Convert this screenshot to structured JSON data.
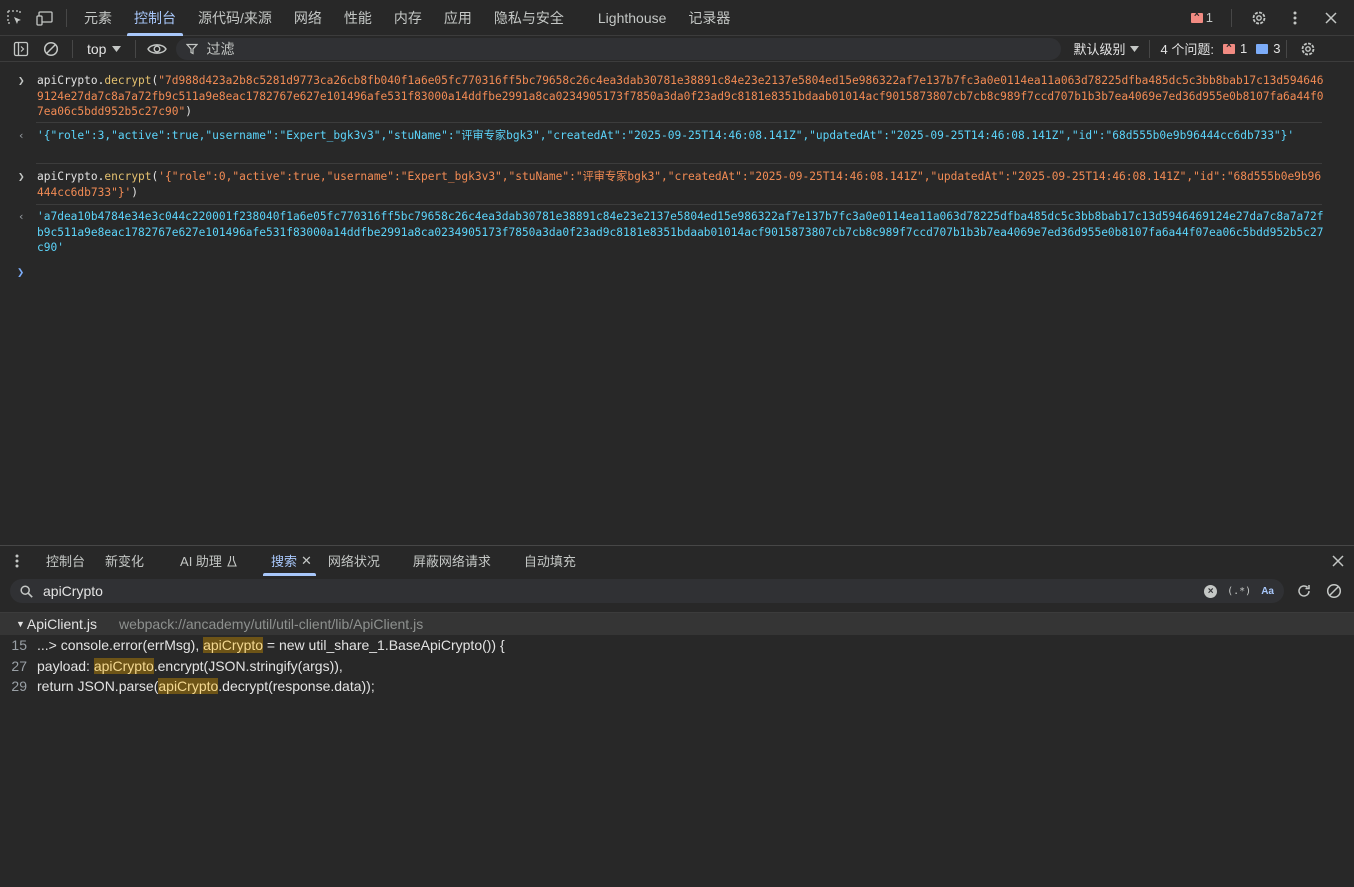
{
  "main_tabs": {
    "items": [
      "元素",
      "控制台",
      "源代码/来源",
      "网络",
      "性能",
      "内存",
      "应用",
      "隐私与安全",
      "Lighthouse",
      "记录器"
    ],
    "active_index": 1,
    "error_count": "1"
  },
  "console_toolbar": {
    "context": "top",
    "filter_placeholder": "过滤",
    "level": "默认级别",
    "issues_label": "4 个问题:",
    "issues_errors": "1",
    "issues_info": "3"
  },
  "console": {
    "msg1": {
      "obj": "apiCrypto",
      "dot": ".",
      "method": "decrypt",
      "open": "(",
      "arg": "\"7d988d423a2b8c5281d9773ca26cb8fb040f1a6e05fc770316ff5bc79658c26c4ea3dab30781e38891c84e23e2137e5804ed15e986322af7e137b7fc3a0e0114ea11a063d78225dfba485dc5c3bb8bab17c13d5946469124e27da7c8a7a72fb9c511a9e8eac1782767e627e101496afe531f83000a14ddfbe2991a8ca0234905173f7850a3da0f23ad9c8181e8351bdaab01014acf9015873807cb7cb8c989f7ccd707b1b3b7ea4069e7ed36d955e0b8107fa6a44f07ea06c5bdd952b5c27c90\"",
      "close": ")"
    },
    "result1": "'{\"role\":3,\"active\":true,\"username\":\"Expert_bgk3v3\",\"stuName\":\"评审专家bgk3\",\"createdAt\":\"2025-09-25T14:46:08.141Z\",\"updatedAt\":\"2025-09-25T14:46:08.141Z\",\"id\":\"68d555b0e9b96444cc6db733\"}'",
    "msg2": {
      "obj": "apiCrypto",
      "dot": ".",
      "method": "encrypt",
      "open": "(",
      "arg": "'{\"role\":0,\"active\":true,\"username\":\"Expert_bgk3v3\",\"stuName\":\"评审专家bgk3\",\"createdAt\":\"2025-09-25T14:46:08.141Z\",\"updatedAt\":\"2025-09-25T14:46:08.141Z\",\"id\":\"68d555b0e9b96444cc6db733\"}'",
      "close": ")"
    },
    "result2": "'a7dea10b4784e34e3c044c220001f238040f1a6e05fc770316ff5bc79658c26c4ea3dab30781e38891c84e23e2137e5804ed15e986322af7e137b7fc3a0e0114ea11a063d78225dfba485dc5c3bb8bab17c13d5946469124e27da7c8a7a72fb9c511a9e8eac1782767e627e101496afe531f83000a14ddfbe2991a8ca0234905173f7850a3da0f23ad9c8181e8351bdaab01014acf9015873807cb7cb8c989f7ccd707b1b3b7ea4069e7ed36d955e0b8107fa6a44f07ea06c5bdd952b5c27c90'"
  },
  "drawer": {
    "tabs": [
      "控制台",
      "新变化",
      "AI 助理",
      "搜索",
      "网络状况",
      "屏蔽网络请求",
      "自动填充"
    ],
    "active_index": 3
  },
  "search": {
    "query": "apiCrypto",
    "regex_label": "(.*)",
    "case_label": "Aa",
    "file_name": "ApiClient.js",
    "file_path": "webpack://ancademy/util/util-client/lib/ApiClient.js",
    "matches": [
      {
        "line": "15",
        "before": "...> console.error(errMsg), ",
        "hit": "apiCrypto",
        "after": " = new util_share_1.BaseApiCrypto()) {"
      },
      {
        "line": "27",
        "before": "payload: ",
        "hit": "apiCrypto",
        "after": ".encrypt(JSON.stringify(args)),"
      },
      {
        "line": "29",
        "before": "return JSON.parse(",
        "hit": "apiCrypto",
        "after": ".decrypt(response.data));"
      }
    ]
  }
}
